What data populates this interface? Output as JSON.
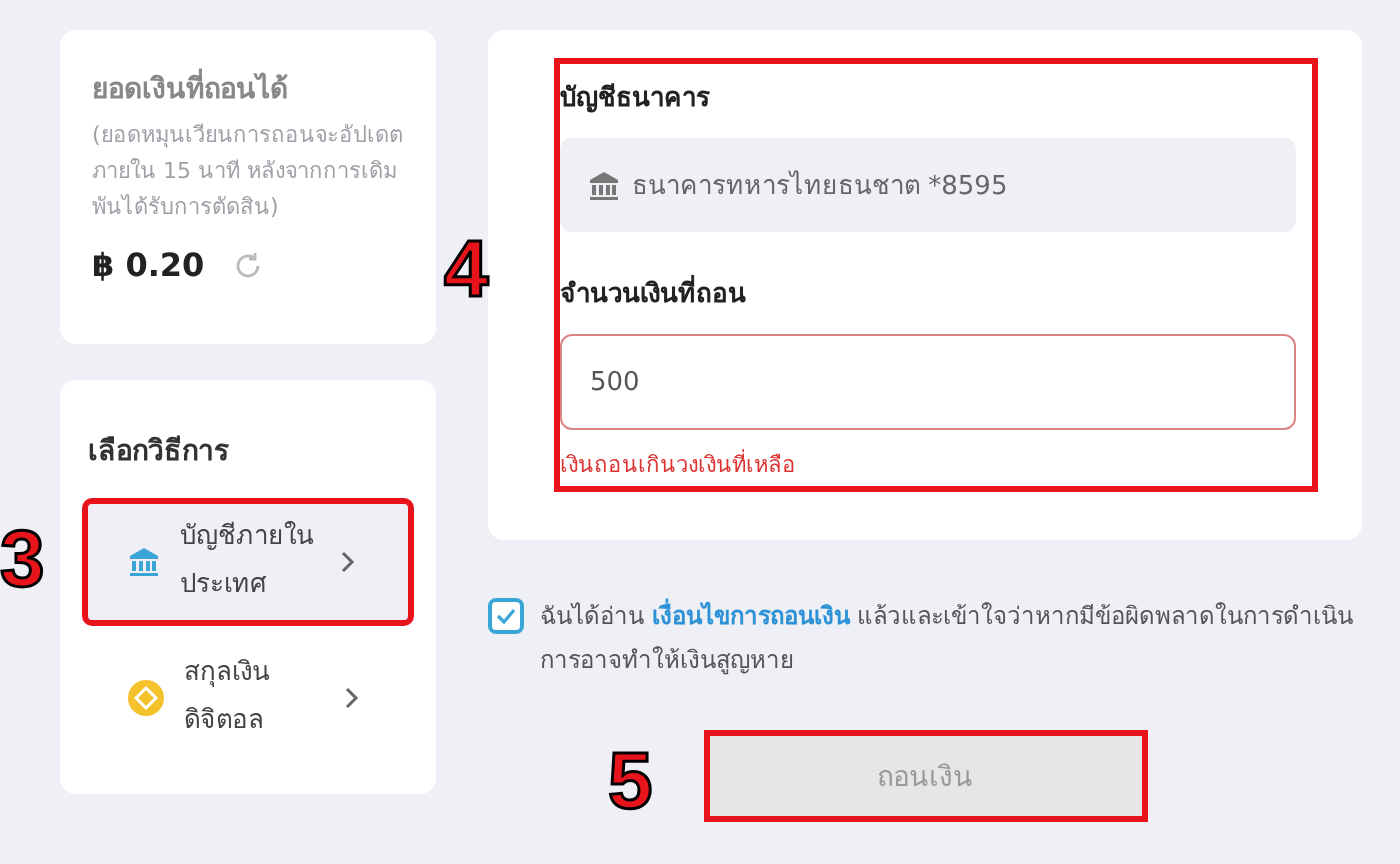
{
  "balance": {
    "title": "ยอดเงินที่ถอนได้",
    "note": "(ยอดหมุนเวียนการถอนจะอัปเดตภายใน 15 นาที หลังจากการเดิมพันได้รับการตัดสิน)",
    "amount": "฿ 0.20"
  },
  "methods": {
    "title": "เลือกวิธีการ",
    "annotation": "3",
    "items": [
      {
        "label": "บัญชีภายในประเทศ",
        "kind": "bank",
        "selected": true,
        "highlighted": true
      },
      {
        "label": "สกุลเงินดิจิตอล",
        "kind": "crypto",
        "selected": false,
        "highlighted": false
      }
    ]
  },
  "form": {
    "highlighted": true,
    "annotation": "4",
    "bank_label": "บัญชีธนาคาร",
    "bank_value": "ธนาคารทหารไทยธนชาต *8595",
    "amount_label": "จำนวนเงินที่ถอน",
    "amount_value": "500",
    "error": "เงินถอนเกินวงเงินที่เหลือ"
  },
  "agreement": {
    "checked": true,
    "before": "ฉันได้อ่าน",
    "link": "เงื่อนไขการถอนเงิน",
    "after": "แล้วและเข้าใจว่าหากมีข้อผิดพลาดในการดำเนินการอาจทำให้เงินสูญหาย"
  },
  "submit": {
    "label": "ถอนเงิน",
    "disabled": true,
    "highlighted": true,
    "annotation": "5"
  }
}
